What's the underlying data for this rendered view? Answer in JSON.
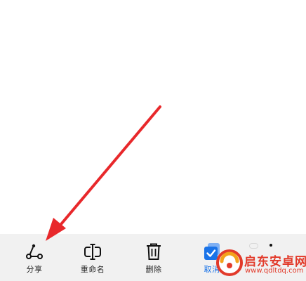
{
  "toolbar": {
    "share": {
      "label": "分享",
      "icon": "share-icon"
    },
    "rename": {
      "label": "重命名",
      "icon": "rename-icon"
    },
    "delete": {
      "label": "删除",
      "icon": "trash-icon"
    },
    "cancel": {
      "label": "取消",
      "icon": "checkbox-checked-icon"
    }
  },
  "pager": {
    "pages": 2,
    "current": 2
  },
  "watermark": {
    "text": "启东安卓网",
    "url": "www.qdltdq.com"
  },
  "colors": {
    "toolbar_bg": "#f1f1f1",
    "accent_blue": "#1a73e8",
    "annotation_red": "#e8282b",
    "watermark_red": "#e23a2a"
  }
}
